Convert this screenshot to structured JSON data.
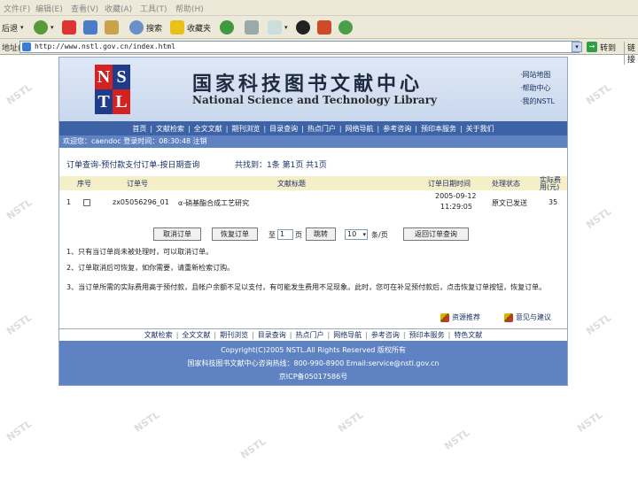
{
  "browser": {
    "menu": [
      "文件(F)",
      "编辑(E)",
      "查看(V)",
      "收藏(A)",
      "工具(T)",
      "帮助(H)"
    ],
    "toolbar": {
      "back_label": "后退",
      "search_label": "搜索",
      "favorites_label": "收藏夹"
    },
    "address_label": "地址(D)",
    "address_value": "http://www.nstl.gov.cn/index.html",
    "go_label": "转到",
    "links_label": "链接"
  },
  "logo": {
    "letters": [
      "N",
      "S",
      "T",
      "L"
    ]
  },
  "header": {
    "title_cn": "国家科技图书文献中心",
    "title_en": "National Science and Technology Library",
    "side_links": [
      "·网站地图",
      "·帮助中心",
      "·我的NSTL"
    ]
  },
  "nav": [
    "首页",
    "文献检索",
    "全文文献",
    "期刊浏览",
    "目录查询",
    "热点门户",
    "网络导航",
    "参考咨询",
    "预印本服务",
    "关于我们"
  ],
  "userbar": "欢迎您：caendoc  登录时间：08:30:48 注销",
  "query": {
    "title": "订单查询-预付款支付订单-按日期查询",
    "total": "共找到：1条  第1页  共1页"
  },
  "table": {
    "headers": [
      "序号",
      "订单号",
      "文献标题",
      "订单日期时间",
      "处理状态",
      "实际费用(元)"
    ],
    "rows": [
      {
        "index": "1",
        "order_no": "zx05056296_01",
        "title": "α-硝基酯合成工艺研究",
        "date": "2005-09-12",
        "time": "11:29:05",
        "status": "原文已发送",
        "fee": "35"
      }
    ]
  },
  "actions": {
    "cancel_label": "取消订单",
    "restore_label": "恢复订单",
    "goto_prefix": "至",
    "page_value": "1",
    "page_suffix": "页",
    "jump_label": "跳转",
    "per_page_value": "10",
    "per_page_suffix": "条/页",
    "back_label": "返回订单查询"
  },
  "notes": [
    "1、只有当订单尚未被处理时，可以取消订单。",
    "2、订单取消后可恢复，如你需要，请重新检索订购。",
    "3、当订单所需的实际费用高于预付款，且帐户余额不足以支付，有可能发生费用不足现象。此时，您可在补足预付款后，点击恢复订单按钮，恢复订单。"
  ],
  "feedback": {
    "recommend": "资源推荐",
    "suggest": "意见与建议"
  },
  "footer_nav": [
    "文献检索",
    "全文文献",
    "期刊浏览",
    "目录查询",
    "热点门户",
    "网络导航",
    "参考咨询",
    "预印本服务",
    "特色文献"
  ],
  "footer": {
    "copyright": "Copyright(C)2005 NSTL.All Rights Reserved 版权所有",
    "contact": "国家科技图书文献中心咨询热线：800-990-8900 Email:service@nstl.gov.cn",
    "icp": "京ICP备05017586号"
  },
  "watermark": "NSTL",
  "colors": {
    "nav_bg": "#3d63a6",
    "userbar_bg": "#5f83c2",
    "table_header_bg": "#f5efc8",
    "header_bg": "#c9d8ee",
    "logo_red": "#d22222",
    "logo_blue": "#1e3c8a"
  }
}
